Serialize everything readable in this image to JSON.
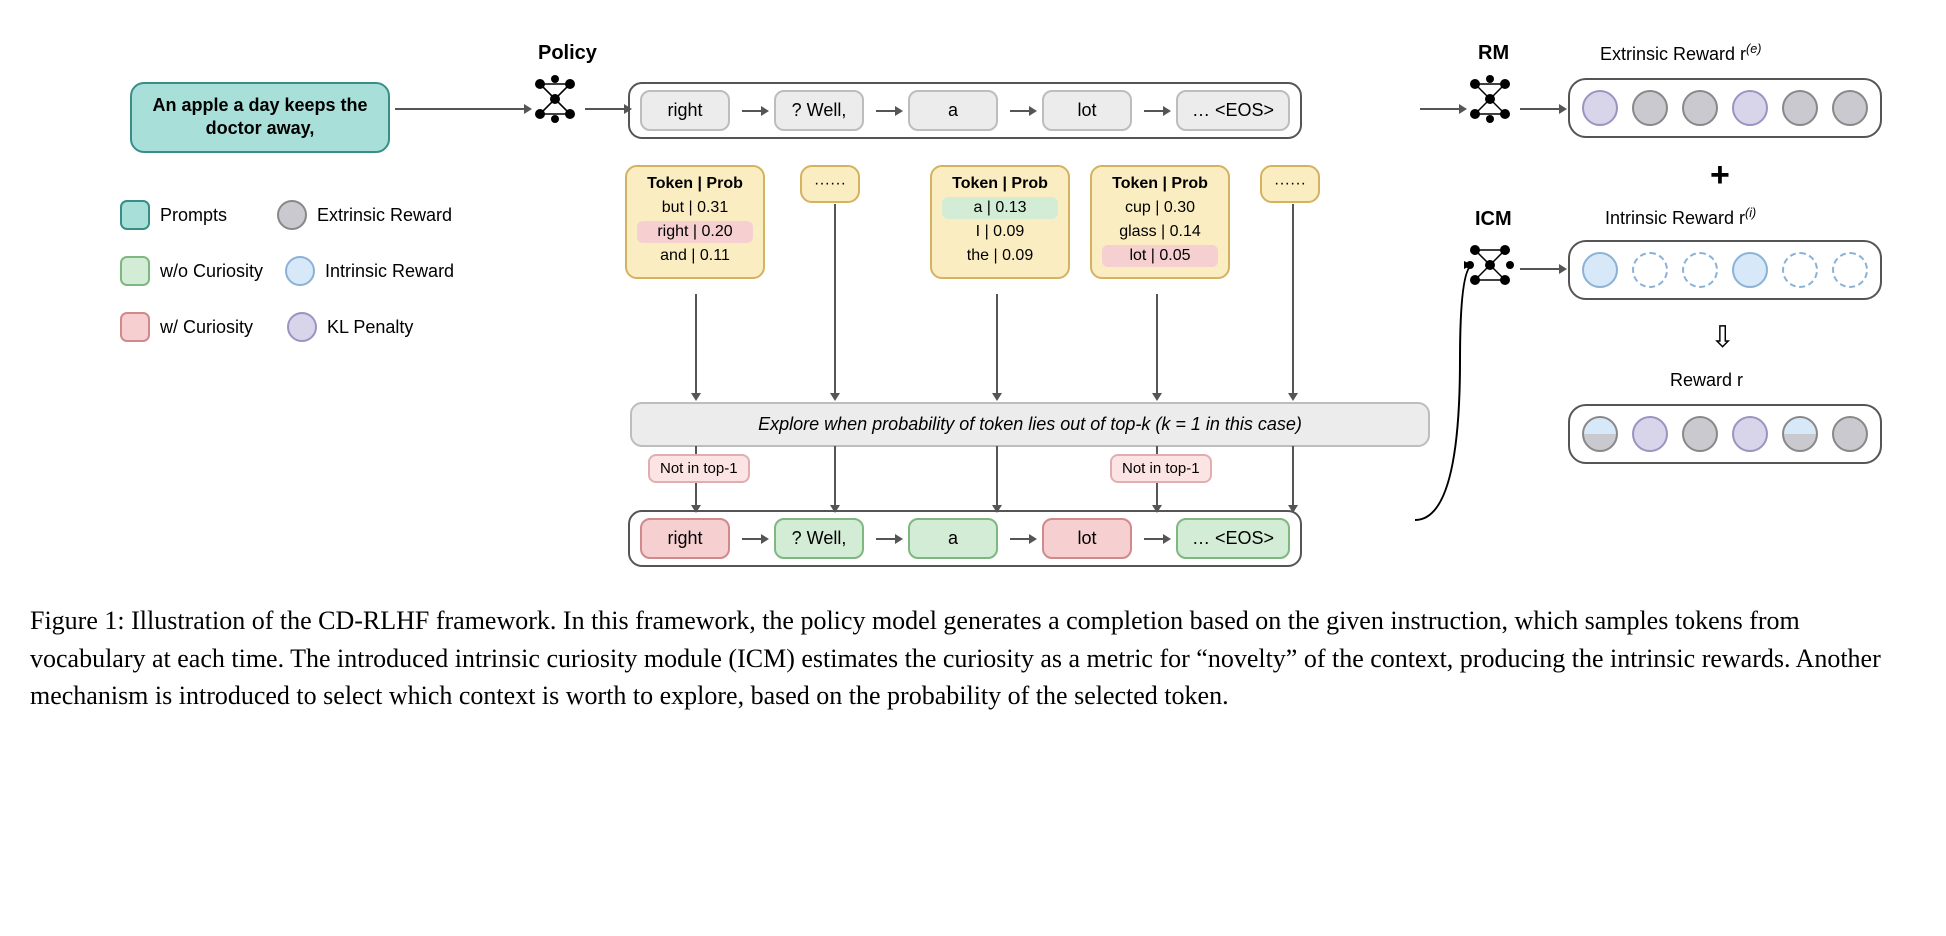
{
  "prompt": "An apple a day keeps the doctor away,",
  "labels": {
    "policy": "Policy",
    "rm": "RM",
    "icm": "ICM",
    "extrinsic": "Extrinsic Reward r",
    "extrinsic_sup": "(e)",
    "intrinsic": "Intrinsic Reward r",
    "intrinsic_sup": "(i)",
    "reward": "Reward r"
  },
  "legend": {
    "prompts": "Prompts",
    "wo": "w/o Curiosity",
    "w": "w/ Curiosity",
    "ext": "Extrinsic Reward",
    "intr": "Intrinsic Reward",
    "kl": "KL Penalty"
  },
  "tokens_top": [
    "right",
    "? Well,",
    "a",
    "lot",
    "… <EOS>"
  ],
  "tokens_bottom": [
    "right",
    "? Well,",
    "a",
    "lot",
    "… <EOS>"
  ],
  "probs": {
    "header": "Token | Prob",
    "dots": "······",
    "c1": [
      "but | 0.31",
      "right | 0.20",
      "and | 0.11"
    ],
    "c3": [
      "a | 0.13",
      "I | 0.09",
      "the | 0.09"
    ],
    "c4": [
      "cup | 0.30",
      "glass | 0.14",
      "lot | 0.05"
    ]
  },
  "explore": "Explore when probability of token lies out of top-k (k = 1 in this case)",
  "not_top": "Not in top-1",
  "caption": "Figure 1: Illustration of the CD-RLHF framework. In this framework, the policy model generates a completion based on the given instruction, which samples tokens from vocabulary at each time. The introduced intrinsic curiosity module (ICM) estimates the curiosity as a metric for “novelty” of the context, producing the intrinsic rewards. Another mechanism is introduced to select which context is worth to explore, based on the probability of the selected token."
}
